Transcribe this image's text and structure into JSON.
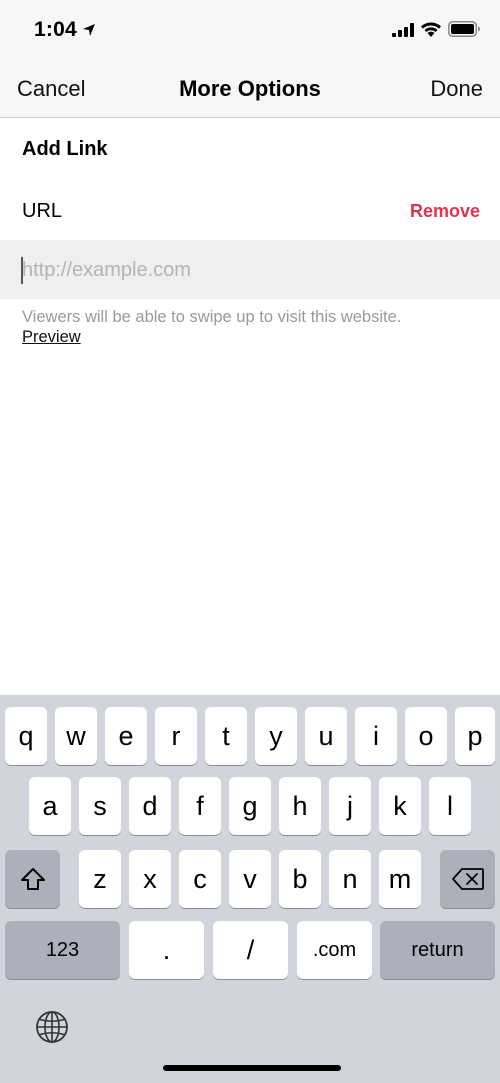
{
  "status_bar": {
    "time": "1:04"
  },
  "nav": {
    "cancel": "Cancel",
    "title": "More Options",
    "done": "Done"
  },
  "content": {
    "section_title": "Add Link",
    "url_label": "URL",
    "remove": "Remove",
    "url_placeholder": "http://example.com",
    "url_value": "",
    "hint": "Viewers will be able to swipe up to visit this website.",
    "preview": "Preview"
  },
  "keyboard": {
    "row1": [
      "q",
      "w",
      "e",
      "r",
      "t",
      "y",
      "u",
      "i",
      "o",
      "p"
    ],
    "row2": [
      "a",
      "s",
      "d",
      "f",
      "g",
      "h",
      "j",
      "k",
      "l"
    ],
    "row3": [
      "z",
      "x",
      "c",
      "v",
      "b",
      "n",
      "m"
    ],
    "numbers": "123",
    "dot": ".",
    "slash": "/",
    "dotcom": ".com",
    "return": "return"
  }
}
